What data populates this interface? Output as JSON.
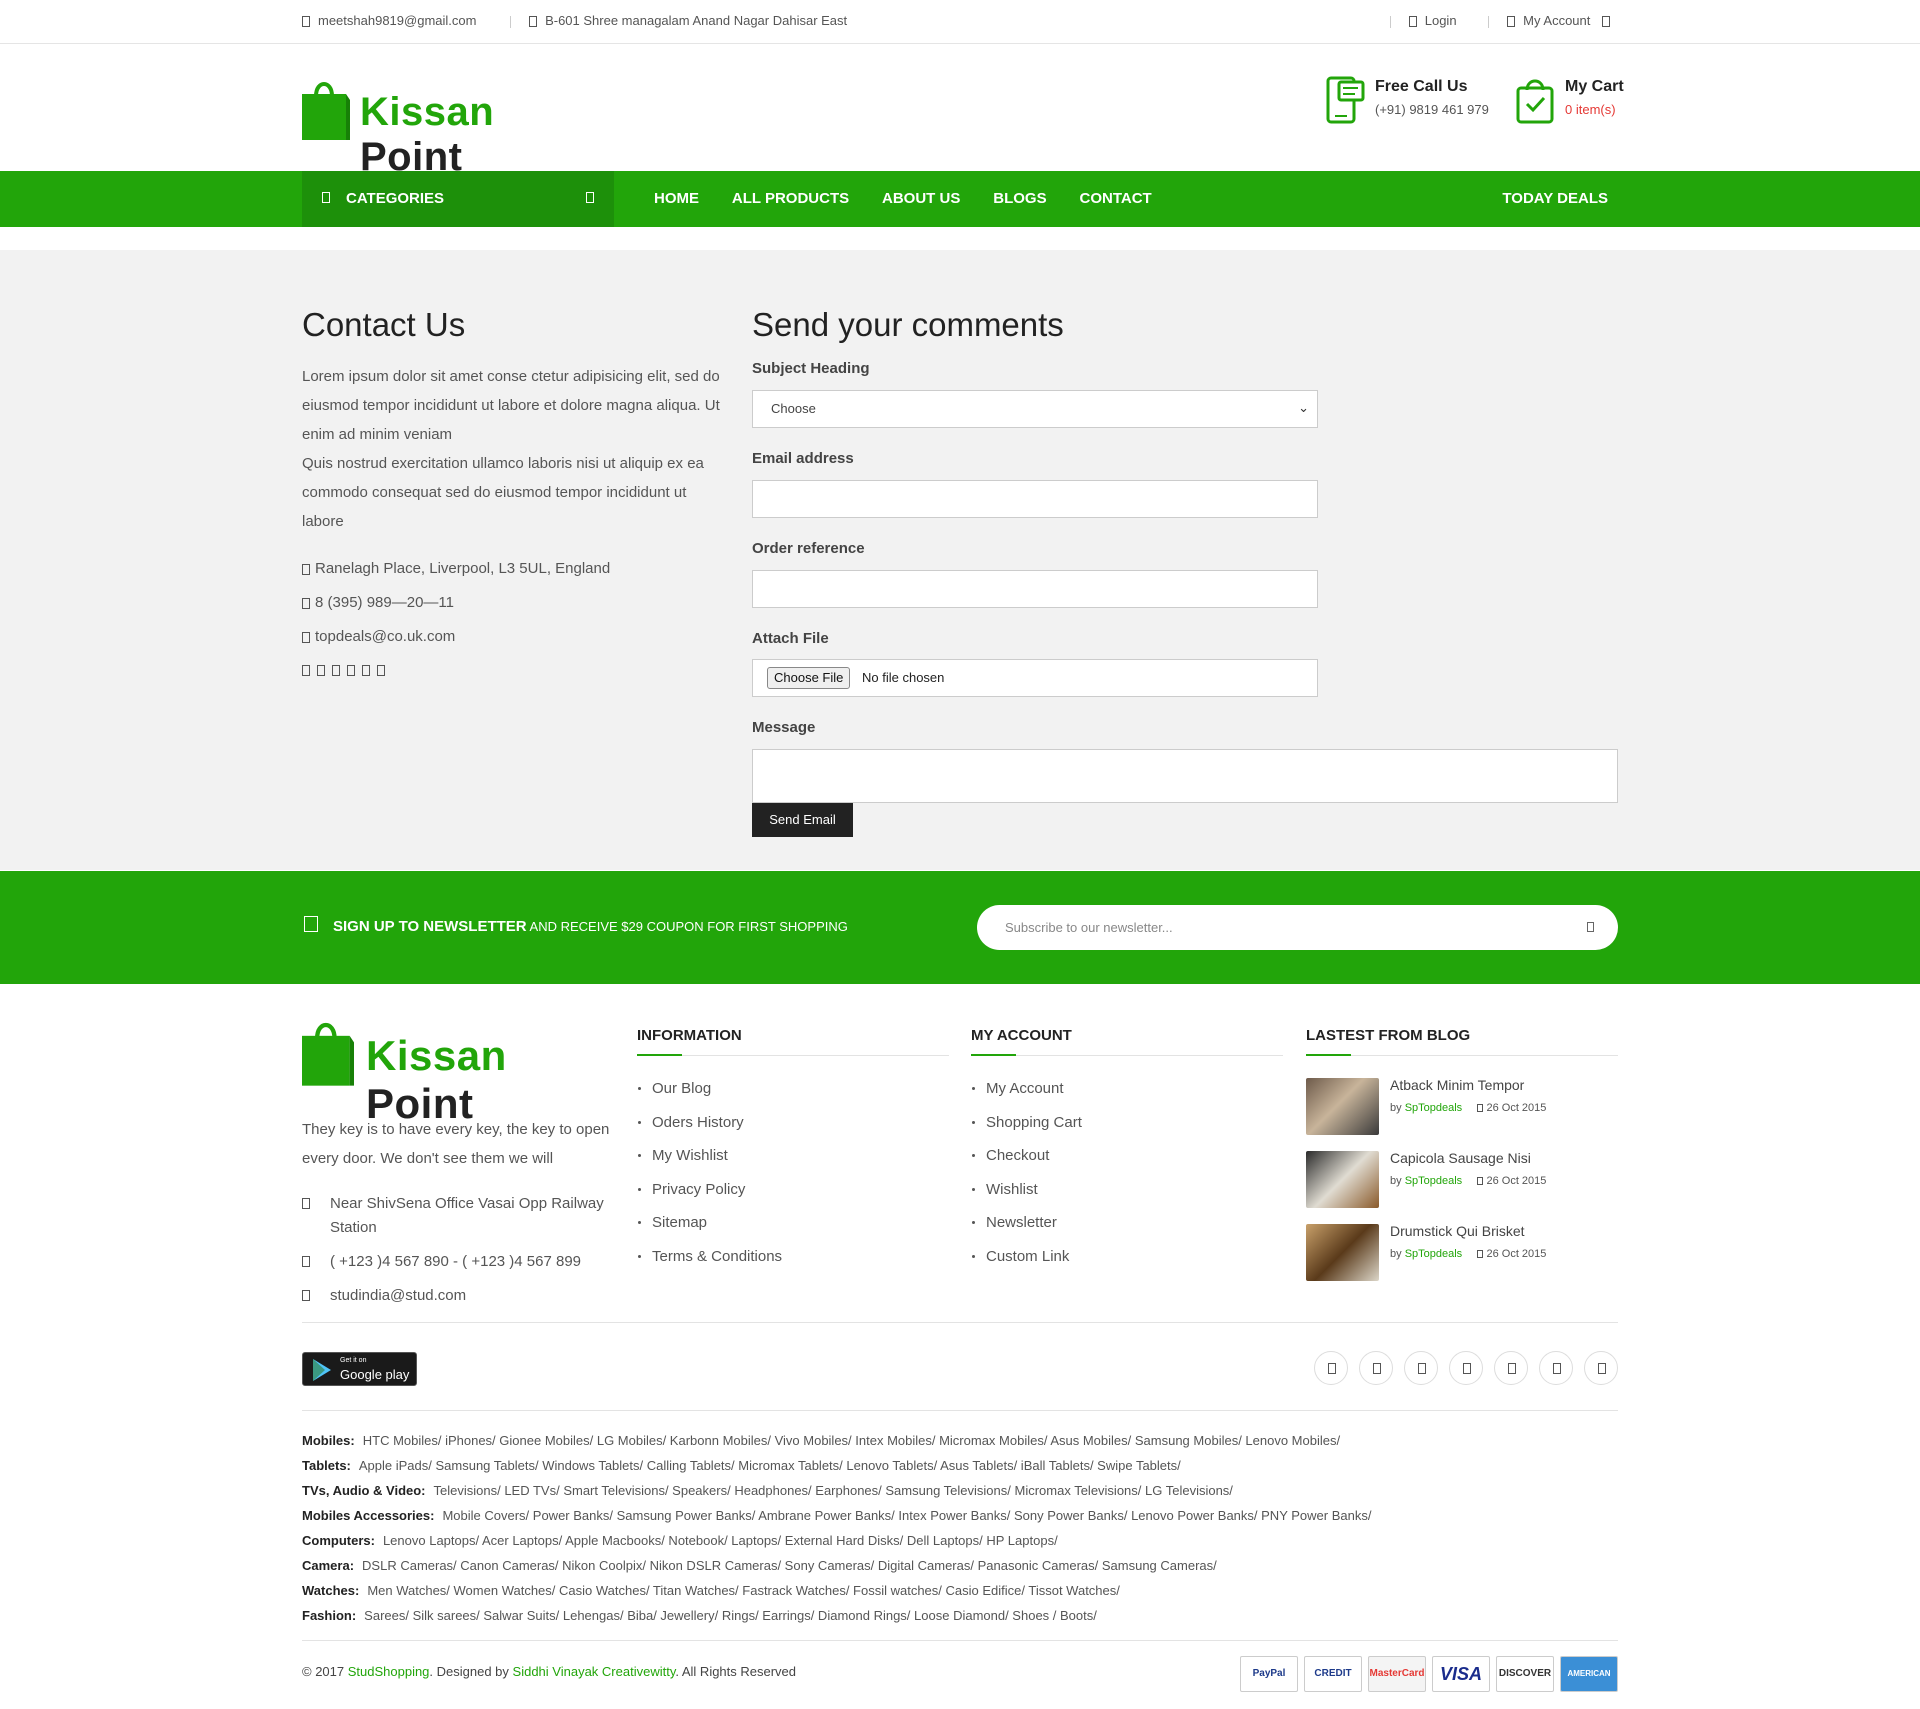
{
  "topbar": {
    "email": "meetshah9819@gmail.com",
    "address": "B-601 Shree managalam Anand Nagar Dahisar East",
    "login": "Login",
    "my_account": "My Account"
  },
  "header": {
    "logo_word1": "Kissan",
    "logo_word2": "Point",
    "call_title": "Free Call Us",
    "call_number": "(+91) 9819 461 979",
    "cart_title": "My Cart",
    "cart_items": "0 item(s)"
  },
  "nav": {
    "categories": "CATEGORIES",
    "items": [
      "HOME",
      "ALL PRODUCTS",
      "ABOUT US",
      "BLOGS",
      "CONTACT"
    ],
    "deals": "TODAY DEALS"
  },
  "contact": {
    "title": "Contact Us",
    "intro1": "Lorem ipsum dolor sit amet conse ctetur adipisicing elit, sed do eiusmod tempor incididunt ut labore et dolore magna aliqua. Ut enim ad minim veniam",
    "intro2": "Quis nostrud exercitation ullamco laboris nisi ut aliquip ex ea commodo consequat sed do eiusmod tempor incididunt ut labore",
    "address": "Ranelagh Place, Liverpool, L3 5UL, England",
    "phone": "8 (395) 989—20—11",
    "email": "topdeals@co.uk.com"
  },
  "form": {
    "title": "Send your comments",
    "subject_label": "Subject Heading",
    "subject_value": "Choose",
    "email_label": "Email address",
    "order_label": "Order reference",
    "attach_label": "Attach File",
    "choose_file": "Choose File",
    "no_file": "No file chosen",
    "message_label": "Message",
    "send": "Send Email"
  },
  "newsletter": {
    "strong": "SIGN UP TO NEWSLETTER",
    "text": " AND RECEIVE $29 COUPON FOR FIRST SHOPPING",
    "placeholder": "Subscribe to our newsletter..."
  },
  "footer": {
    "desc": "They key is to have every key, the key to open every door. We don't see them we will",
    "address": "Near ShivSena Office Vasai Opp Railway Station",
    "phone": "( +123 )4 567 890 - ( +123 )4 567 899",
    "email": "studindia@stud.com",
    "information": {
      "title": "INFORMATION",
      "items": [
        "Our Blog",
        "Oders History",
        "My Wishlist",
        "Privacy Policy",
        "Sitemap",
        "Terms & Conditions"
      ]
    },
    "account": {
      "title": "MY ACCOUNT",
      "items": [
        "My Account",
        "Shopping Cart",
        "Checkout",
        "Wishlist",
        "Newsletter",
        "Custom Link"
      ]
    },
    "blog": {
      "title": "LASTEST FROM BLOG",
      "posts": [
        {
          "title": "Atback Minim Tempor",
          "by": "by",
          "author": "SpTopdeals",
          "date": "26 Oct 2015"
        },
        {
          "title": "Capicola Sausage Nisi",
          "by": "by",
          "author": "SpTopdeals",
          "date": "26 Oct 2015"
        },
        {
          "title": "Drumstick Qui Brisket",
          "by": "by",
          "author": "SpTopdeals",
          "date": "26 Oct 2015"
        }
      ]
    },
    "gplay_small": "Get it on",
    "gplay_big": "Google play",
    "links": [
      {
        "cat": "Mobiles:",
        "items": "HTC Mobiles/ iPhones/ Gionee Mobiles/ LG Mobiles/ Karbonn Mobiles/ Vivo Mobiles/ Intex Mobiles/ Micromax Mobiles/ Asus Mobiles/ Samsung Mobiles/ Lenovo Mobiles/"
      },
      {
        "cat": "Tablets:",
        "items": "Apple iPads/ Samsung Tablets/ Windows Tablets/ Calling Tablets/ Micromax Tablets/ Lenovo Tablets/ Asus Tablets/ iBall Tablets/ Swipe Tablets/"
      },
      {
        "cat": "TVs, Audio & Video:",
        "items": "Televisions/ LED TVs/ Smart Televisions/ Speakers/ Headphones/ Earphones/ Samsung Televisions/ Micromax Televisions/ LG Televisions/"
      },
      {
        "cat": "Mobiles Accessories:",
        "items": "Mobile Covers/ Power Banks/ Samsung Power Banks/ Ambrane Power Banks/ Intex Power Banks/ Sony Power Banks/ Lenovo Power Banks/ PNY Power Banks/"
      },
      {
        "cat": "Computers:",
        "items": "Lenovo Laptops/ Acer Laptops/ Apple Macbooks/ Notebook/ Laptops/ External Hard Disks/ Dell Laptops/ HP Laptops/"
      },
      {
        "cat": "Camera:",
        "items": "DSLR Cameras/ Canon Cameras/ Nikon Coolpix/ Nikon DSLR Cameras/ Sony Cameras/ Digital Cameras/ Panasonic Cameras/ Samsung Cameras/"
      },
      {
        "cat": "Watches:",
        "items": "Men Watches/ Women Watches/ Casio Watches/ Titan Watches/ Fastrack Watches/ Fossil watches/ Casio Edifice/ Tissot Watches/"
      },
      {
        "cat": "Fashion:",
        "items": "Sarees/ Silk sarees/ Salwar Suits/ Lehengas/ Biba/ Jewellery/ Rings/ Earrings/ Diamond Rings/ Loose Diamond/ Shoes / Boots/"
      }
    ],
    "copy_pre": "© 2017 ",
    "copy_brand": "StudShopping",
    "copy_mid": ". Designed by ",
    "copy_designer": "Siddhi Vinayak Creativewitty",
    "copy_post": ". All Rights Reserved",
    "payments": [
      "PayPal",
      "CREDIT",
      "MasterCard",
      "VISA",
      "DISCOVER",
      "AMERICAN EXPRESS"
    ]
  },
  "colors": {
    "brand_green": "#22a50a",
    "dark_green": "#1d900a",
    "cart_red": "#e53935"
  }
}
